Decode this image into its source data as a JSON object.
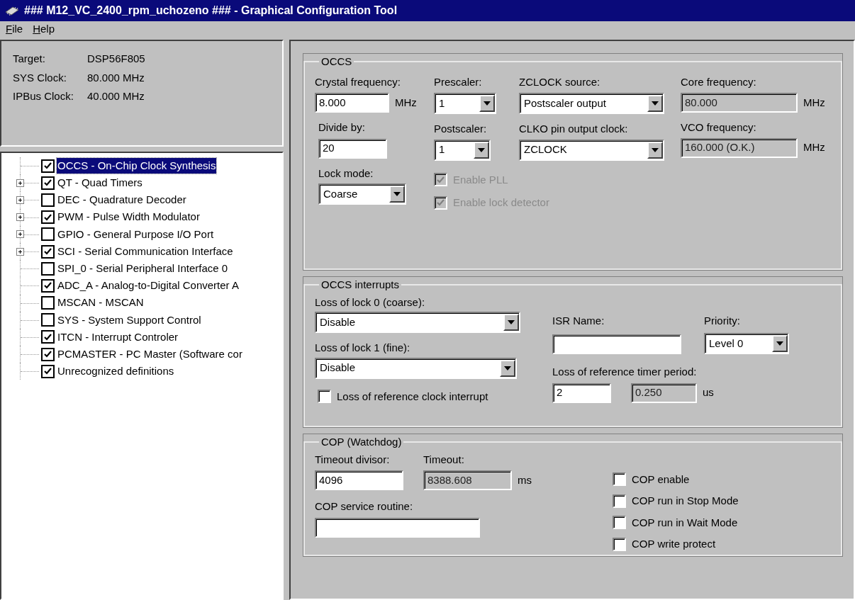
{
  "window": {
    "title": "### M12_VC_2400_rpm_uchozeno ### - Graphical Configuration Tool"
  },
  "menu": [
    {
      "label": "File"
    },
    {
      "label": "Help"
    }
  ],
  "info": [
    {
      "label": "Target:",
      "value": "DSP56F805"
    },
    {
      "label": "SYS Clock:",
      "value": "80.000 MHz"
    },
    {
      "label": "IPBus Clock:",
      "value": "40.000 MHz"
    }
  ],
  "tree": [
    {
      "label": "OCCS - On-Chip Clock Synthesis",
      "kind": "leaf",
      "checked": true,
      "selected": true
    },
    {
      "label": "QT - Quad Timers",
      "kind": "branch",
      "checked": true,
      "selected": false
    },
    {
      "label": "DEC - Quadrature Decoder",
      "kind": "branch",
      "checked": false,
      "selected": false
    },
    {
      "label": "PWM - Pulse Width Modulator",
      "kind": "branch",
      "checked": true,
      "selected": false
    },
    {
      "label": "GPIO - General Purpose I/O Port",
      "kind": "branch",
      "checked": false,
      "selected": false
    },
    {
      "label": "SCI - Serial Communication Interface",
      "kind": "branch",
      "checked": true,
      "selected": false
    },
    {
      "label": "SPI_0 - Serial Peripheral Interface 0",
      "kind": "leaf",
      "checked": false,
      "selected": false
    },
    {
      "label": "ADC_A - Analog-to-Digital Converter A",
      "kind": "leaf",
      "checked": true,
      "selected": false
    },
    {
      "label": "MSCAN - MSCAN",
      "kind": "leaf",
      "checked": false,
      "selected": false
    },
    {
      "label": "SYS - System Support Control",
      "kind": "leaf",
      "checked": false,
      "selected": false
    },
    {
      "label": "ITCN - Interrupt Controler",
      "kind": "leaf",
      "checked": true,
      "selected": false
    },
    {
      "label": "PCMASTER - PC Master (Software cor",
      "kind": "leaf",
      "checked": true,
      "selected": false
    },
    {
      "label": "Unrecognized definitions",
      "kind": "leaf",
      "checked": true,
      "selected": false
    }
  ],
  "occs": {
    "title": "OCCS",
    "crystal_frequency": {
      "label": "Crystal frequency:",
      "value": "8.000",
      "unit": "MHz"
    },
    "divide_by": {
      "label": "Divide by:",
      "value": "20"
    },
    "lock_mode": {
      "label": "Lock mode:",
      "value": "Coarse"
    },
    "prescaler": {
      "label": "Prescaler:",
      "value": "1"
    },
    "postscaler": {
      "label": "Postscaler:",
      "value": "1"
    },
    "zclock_source": {
      "label": "ZCLOCK source:",
      "value": "Postscaler output"
    },
    "clko": {
      "label": "CLKO pin output clock:",
      "value": "ZCLOCK"
    },
    "core_frequency": {
      "label": "Core frequency:",
      "value": "80.000",
      "unit": "MHz",
      "readonly": true
    },
    "vco_frequency": {
      "label": "VCO frequency:",
      "value": "160.000 (O.K.)",
      "unit": "MHz",
      "readonly": true
    },
    "checkboxes": [
      {
        "label": "Enable PLL",
        "checked": true,
        "disabled": true
      },
      {
        "label": "Enable lock detector",
        "checked": true,
        "disabled": true
      }
    ]
  },
  "interrupts": {
    "title": "OCCS interrupts",
    "loss_of_lock_0": {
      "label": "Loss of lock 0 (coarse):",
      "value": "Disable"
    },
    "loss_of_lock_1": {
      "label": "Loss of lock 1 (fine):",
      "value": "Disable"
    },
    "ref_clock_interrupt": {
      "label": "Loss of reference clock interrupt",
      "checked": false,
      "disabled": false
    },
    "isr_name": {
      "label": "ISR Name:"
    },
    "priority": {
      "label": "Priority:",
      "value": "Level 0"
    },
    "timer_period": {
      "label": "Loss of reference timer period:",
      "value": "2",
      "computed": "0.250",
      "unit": "us"
    }
  },
  "cop": {
    "title": "COP (Watchdog)",
    "timeout_divisor": {
      "label": "Timeout divisor:",
      "value": "4096"
    },
    "timeout": {
      "label": "Timeout:",
      "value": "8388.608",
      "unit": "ms",
      "readonly": true
    },
    "service_routine": {
      "label": "COP service routine:"
    },
    "checkboxes": [
      {
        "label": "COP enable",
        "checked": false,
        "disabled": false
      },
      {
        "label": "COP run in Stop Mode",
        "checked": false,
        "disabled": false
      },
      {
        "label": "COP run in Wait Mode",
        "checked": false,
        "disabled": false
      },
      {
        "label": "COP write protect",
        "checked": false,
        "disabled": false
      }
    ]
  }
}
